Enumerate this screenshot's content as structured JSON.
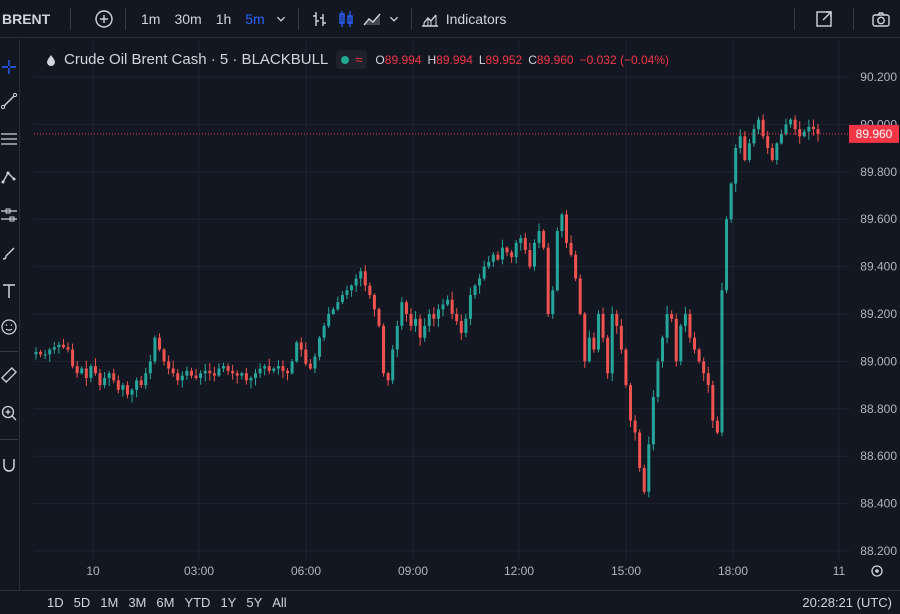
{
  "toolbar": {
    "symbol": "BRENT",
    "intervals": [
      "1m",
      "30m",
      "1h",
      "5m"
    ],
    "active_interval": "5m",
    "indicators_label": "Indicators"
  },
  "legend": {
    "title": "Crude Oil Brent Cash · 5 · BLACKBULL",
    "open_key": "O",
    "open": "89.994",
    "high_key": "H",
    "high": "89.994",
    "low_key": "L",
    "low": "89.952",
    "close_key": "C",
    "close": "89.960",
    "change": "−0.032 (−0.04%)"
  },
  "bottom": {
    "ranges": [
      "1D",
      "5D",
      "1M",
      "3M",
      "6M",
      "YTD",
      "1Y",
      "5Y",
      "All"
    ],
    "clock": "20:28:21 (UTC)"
  },
  "colors": {
    "up": "#26a69a",
    "down": "#ef5350",
    "background": "#131722",
    "grid": "#1f2330",
    "active": "#2962ff",
    "price_label": "#f23645"
  },
  "chart_data": {
    "type": "candlestick",
    "y_ticks": [
      "88.200",
      "88.400",
      "88.600",
      "88.800",
      "89.000",
      "89.200",
      "89.400",
      "89.600",
      "89.800",
      "90.000",
      "90.200"
    ],
    "ylim": [
      88.2,
      90.2
    ],
    "x_ticks": [
      "10",
      "03:00",
      "06:00",
      "09:00",
      "12:00",
      "15:00",
      "18:00",
      "11"
    ],
    "last_price_label": "89.960",
    "last_price": 89.96,
    "close_series": [
      89.04,
      89.03,
      89.03,
      89.05,
      89.06,
      89.07,
      89.06,
      89.05,
      88.98,
      88.95,
      88.97,
      88.93,
      88.98,
      88.95,
      88.9,
      88.93,
      88.95,
      88.92,
      88.88,
      88.9,
      88.86,
      88.88,
      88.92,
      88.9,
      88.95,
      89.0,
      89.1,
      89.05,
      89.0,
      88.97,
      88.95,
      88.92,
      88.94,
      88.96,
      88.94,
      88.93,
      88.95,
      88.96,
      88.95,
      88.94,
      88.97,
      88.98,
      88.96,
      88.95,
      88.94,
      88.95,
      88.92,
      88.93,
      88.95,
      88.97,
      88.98,
      88.96,
      88.97,
      88.98,
      88.96,
      88.95,
      89.0,
      89.08,
      89.05,
      88.99,
      88.97,
      89.02,
      89.1,
      89.15,
      89.2,
      89.22,
      89.25,
      89.28,
      89.3,
      89.32,
      89.35,
      89.38,
      89.32,
      89.28,
      89.22,
      89.15,
      88.95,
      88.92,
      89.05,
      89.15,
      89.25,
      89.2,
      89.15,
      89.18,
      89.1,
      89.15,
      89.2,
      89.18,
      89.22,
      89.24,
      89.26,
      89.2,
      89.17,
      89.12,
      89.18,
      89.28,
      89.32,
      89.35,
      89.4,
      89.42,
      89.45,
      89.43,
      89.48,
      89.46,
      89.44,
      89.5,
      89.52,
      89.47,
      89.4,
      89.5,
      89.55,
      89.48,
      89.2,
      89.3,
      89.55,
      89.62,
      89.5,
      89.45,
      89.35,
      89.2,
      89.0,
      89.1,
      89.05,
      89.2,
      89.1,
      88.95,
      89.2,
      89.15,
      89.05,
      88.9,
      88.75,
      88.7,
      88.55,
      88.45,
      88.65,
      88.85,
      89.0,
      89.1,
      89.2,
      89.18,
      89.0,
      89.15,
      89.2,
      89.1,
      89.05,
      89.0,
      88.95,
      88.9,
      88.75,
      88.7,
      89.3,
      89.6,
      89.75,
      89.9,
      89.95,
      89.85,
      89.92,
      89.98,
      90.02,
      89.95,
      89.9,
      89.85,
      89.92,
      89.96,
      90.0,
      90.02,
      89.98,
      89.95,
      89.97,
      89.99,
      89.98,
      89.96
    ]
  }
}
